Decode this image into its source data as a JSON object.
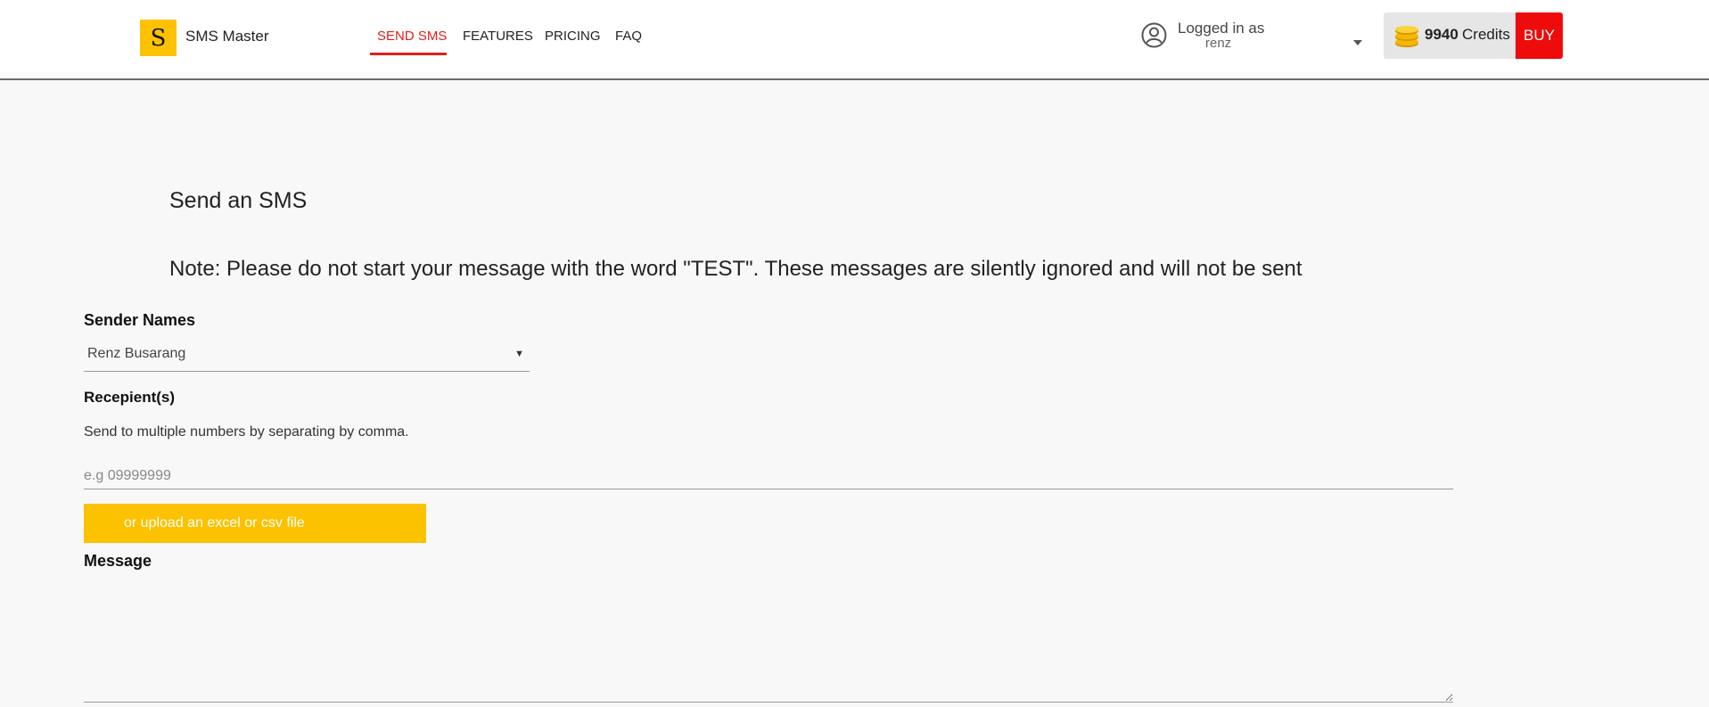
{
  "navbar": {
    "logo_letter": "S",
    "brand": "SMS Master",
    "links": [
      {
        "label": "SEND SMS",
        "active": true
      },
      {
        "label": "FEATURES",
        "active": false
      },
      {
        "label": "PRICING",
        "active": false
      },
      {
        "label": "FAQ",
        "active": false
      }
    ],
    "user": {
      "logged_label": "Logged in as",
      "username": "renz"
    },
    "credits": {
      "amount": "9940",
      "label": "Credits",
      "buy_label": "BUY"
    }
  },
  "main": {
    "title": "Send an SMS",
    "note": "Note: Please do not start your message with the word \"TEST\". These messages are silently ignored and will not be sent",
    "sender": {
      "label": "Sender Names",
      "value": "Renz Busarang"
    },
    "recipients": {
      "label": "Recepient(s)",
      "helper": "Send to multiple numbers by separating by comma.",
      "placeholder": "e.g 09999999"
    },
    "upload_label": "or upload an excel or csv file",
    "message_label": "Message"
  },
  "colors": {
    "accent_red": "#e0201b",
    "brand_yellow": "#fcc200",
    "buy_red": "#ee0b0b"
  }
}
